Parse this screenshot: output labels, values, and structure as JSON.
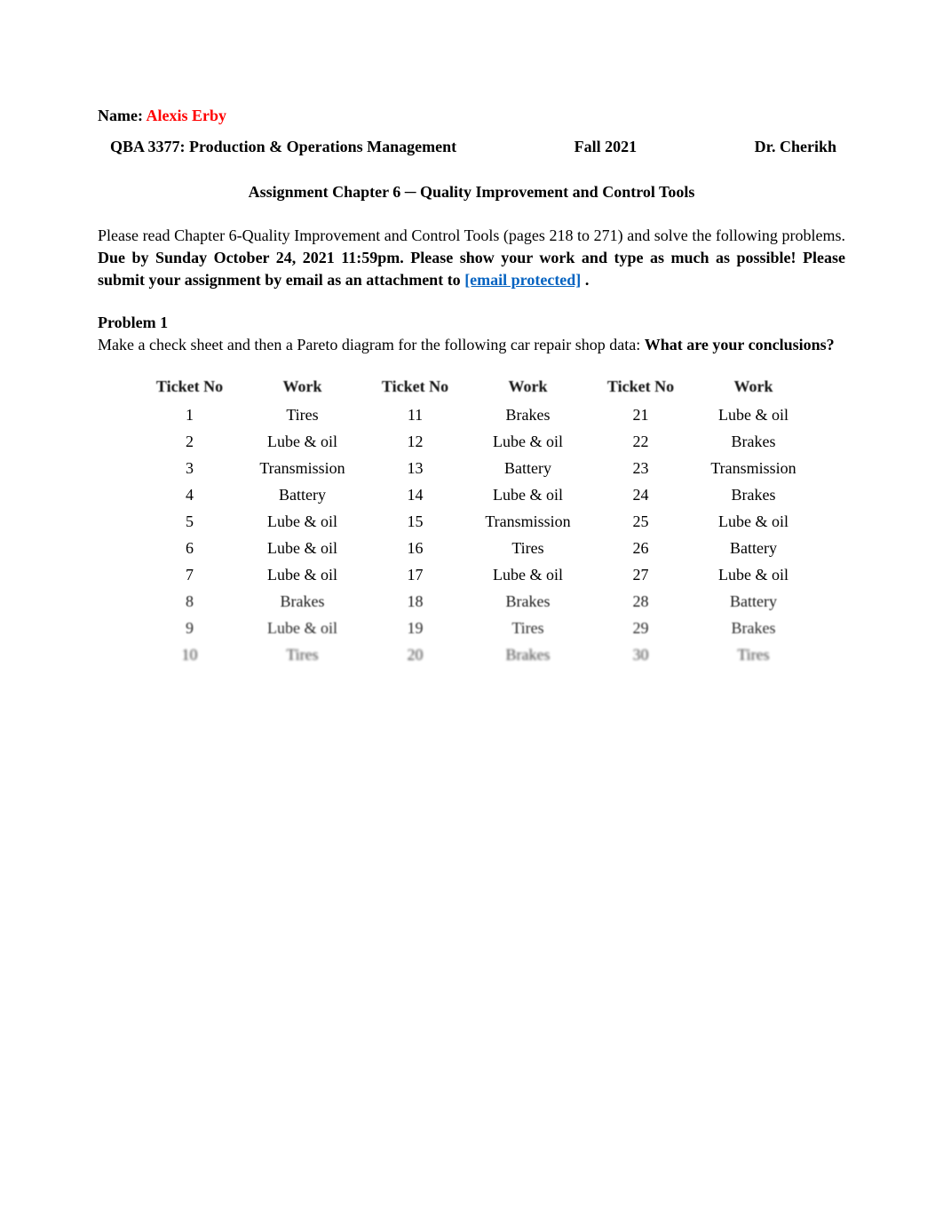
{
  "header": {
    "name_label": "Name: ",
    "name_value": "Alexis Erby",
    "course": "QBA 3377: Production & Operations Management",
    "term": "Fall 2021",
    "instructor": "Dr. Cherikh"
  },
  "assignment": {
    "title": "Assignment Chapter 6 ─ Quality Improvement and Control Tools",
    "intro_plain": "Please read Chapter 6-Quality Improvement and Control Tools (pages 218 to 271) and solve the following problems. ",
    "intro_bold": "Due by Sunday October 24, 2021 11:59pm. Please show your work and type as much as possible! Please submit your assignment by email as an attachment to ",
    "email_text": "[email protected]",
    "intro_tail": "       ."
  },
  "problem1": {
    "title": "Problem 1",
    "text_plain": "Make a check sheet and then a Pareto diagram for the following car repair shop data: ",
    "text_bold": "What are your conclusions?"
  },
  "table": {
    "headers": {
      "ticket": "Ticket No",
      "work": "Work"
    },
    "rows": [
      {
        "c1": "1",
        "c2": "Tires",
        "c3": "11",
        "c4": "Brakes",
        "c5": "21",
        "c6": "Lube & oil"
      },
      {
        "c1": "2",
        "c2": "Lube & oil",
        "c3": "12",
        "c4": "Lube & oil",
        "c5": "22",
        "c6": "Brakes"
      },
      {
        "c1": "3",
        "c2": "Transmission",
        "c3": "13",
        "c4": "Battery",
        "c5": "23",
        "c6": "Transmission"
      },
      {
        "c1": "4",
        "c2": "Battery",
        "c3": "14",
        "c4": "Lube & oil",
        "c5": "24",
        "c6": "Brakes"
      },
      {
        "c1": "5",
        "c2": "Lube & oil",
        "c3": "15",
        "c4": "Transmission",
        "c5": "25",
        "c6": "Lube & oil"
      },
      {
        "c1": "6",
        "c2": "Lube & oil",
        "c3": "16",
        "c4": "Tires",
        "c5": "26",
        "c6": "Battery"
      },
      {
        "c1": "7",
        "c2": "Lube & oil",
        "c3": "17",
        "c4": "Lube & oil",
        "c5": "27",
        "c6": "Lube & oil"
      },
      {
        "c1": "8",
        "c2": "Brakes",
        "c3": "18",
        "c4": "Brakes",
        "c5": "28",
        "c6": "Battery"
      },
      {
        "c1": "9",
        "c2": "Lube & oil",
        "c3": "19",
        "c4": "Tires",
        "c5": "29",
        "c6": "Brakes"
      },
      {
        "c1": "10",
        "c2": "Tires",
        "c3": "20",
        "c4": "Brakes",
        "c5": "30",
        "c6": "Tires"
      }
    ]
  }
}
